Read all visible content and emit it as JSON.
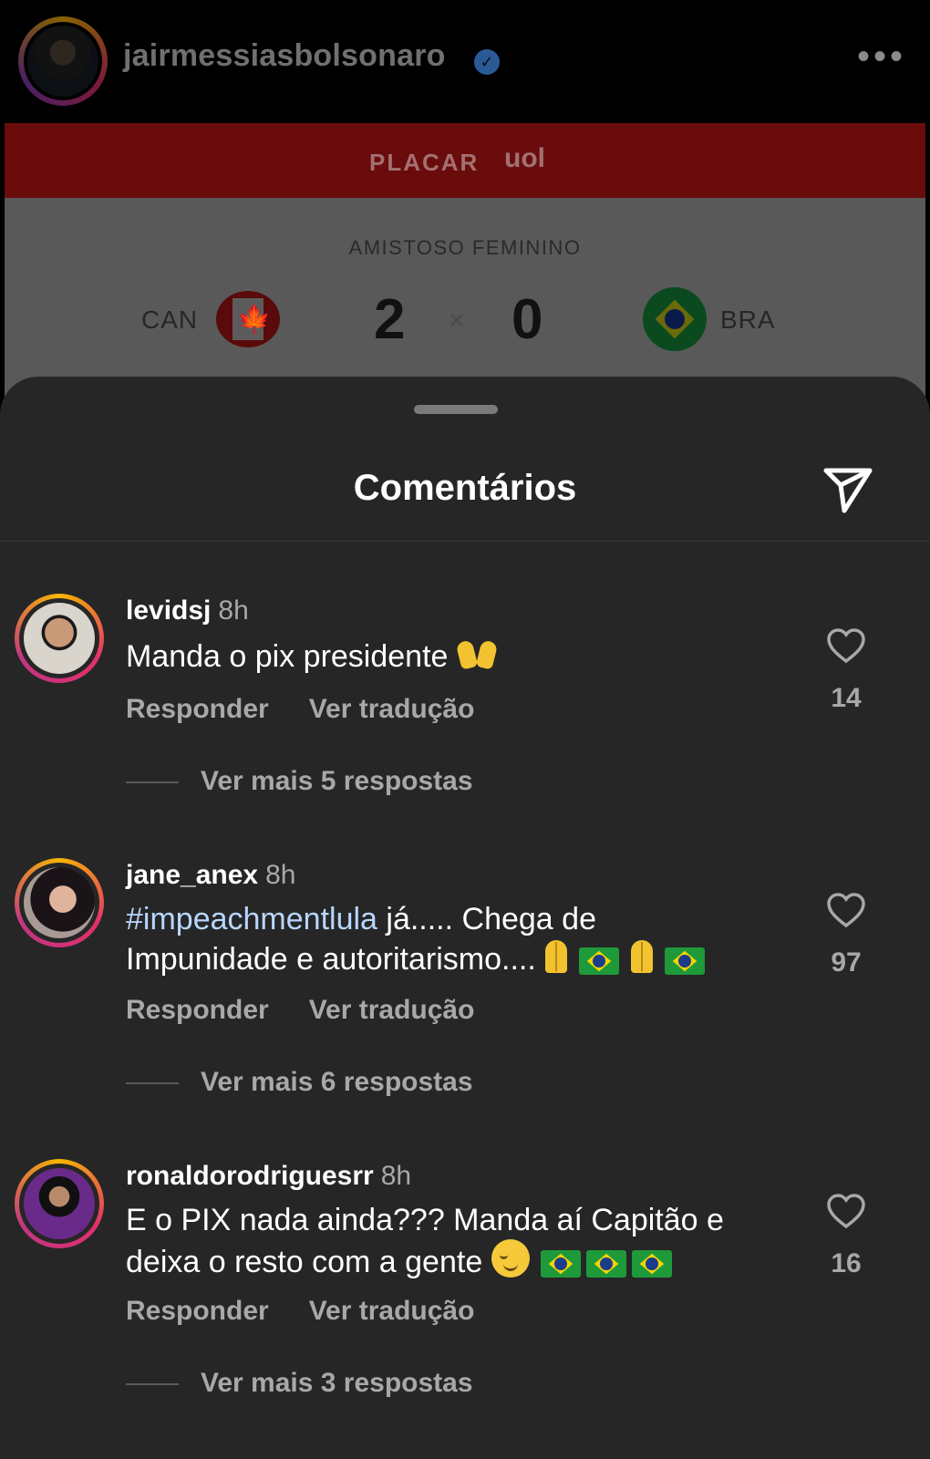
{
  "header": {
    "username": "jairmessiasbolsonaro",
    "verified_icon": "✓",
    "more_icon": "•••"
  },
  "post": {
    "banner_label": "PLACAR",
    "brand": "uol",
    "event": "AMISTOSO FEMININO",
    "team_home": "CAN",
    "team_away": "BRA",
    "score_home": "2",
    "score_separator": "×",
    "score_away": "0",
    "flag_leaf": "🍁"
  },
  "sheet": {
    "title": "Comentários"
  },
  "comments": [
    {
      "username": "levidsj",
      "time": "8h",
      "text": "Manda o pix presidente",
      "reply_label": "Responder",
      "translate_label": "Ver tradução",
      "more_replies": "Ver mais 5 respostas",
      "likes": "14"
    },
    {
      "username": "jane_anex",
      "time": "8h",
      "hashtag": "#impeachmentlula",
      "text_line1": " já..... Chega de",
      "text_line2": "Impunidade e autoritarismo....",
      "reply_label": "Responder",
      "translate_label": "Ver tradução",
      "more_replies": "Ver mais 6 respostas",
      "likes": "97"
    },
    {
      "username": "ronaldorodriguesrr",
      "time": "8h",
      "text_line1": "E o PIX nada ainda??? Manda aí Capitão e",
      "text_line2": "deixa o resto com a gente",
      "reply_label": "Responder",
      "translate_label": "Ver tradução",
      "more_replies": "Ver mais 3 respostas",
      "likes": "16"
    }
  ],
  "colors": {
    "sheet_bg": "#262626",
    "text_primary": "#ffffff",
    "text_secondary": "#a8a8a8",
    "hashtag": "#b9d6ff"
  }
}
